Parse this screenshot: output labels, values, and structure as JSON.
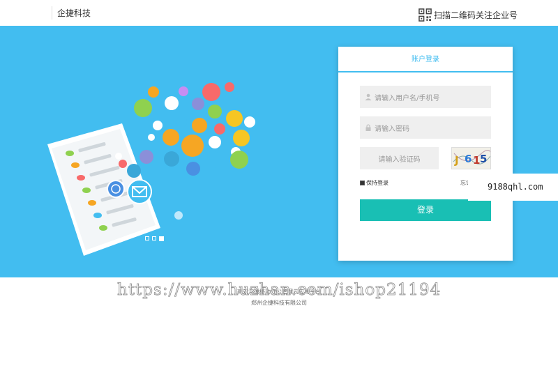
{
  "header": {
    "brand": "企捷科技",
    "qr_text": "扫描二维码关注企业号"
  },
  "login": {
    "title": "账户登录",
    "username_placeholder": "请输入用户名/手机号",
    "password_placeholder": "请输入密码",
    "code_placeholder": "请输入验证码",
    "captcha_text": "J615",
    "remember_label": "保持登录",
    "forgot_label": "忘记",
    "submit_label": "登录"
  },
  "carousel": {
    "count": 3,
    "active_index": 2
  },
  "badge": {
    "text": "9188qhl.com"
  },
  "footer": {
    "line1": "高效沟通移动办公管理云应用平台",
    "line2": "郑州企捷科技有限公司"
  },
  "watermark": {
    "text": "https://www.huzhan.com/ishop21194"
  },
  "colors": {
    "banner": "#42bdf0",
    "button": "#19bfb4",
    "accent": "#42bdf0"
  }
}
